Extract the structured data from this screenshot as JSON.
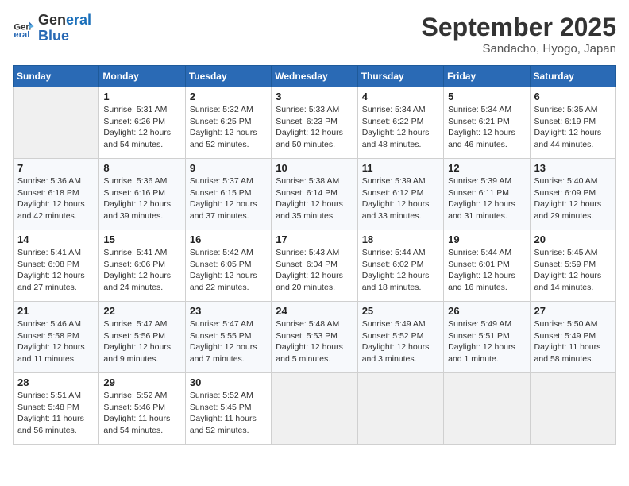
{
  "header": {
    "logo_line1": "General",
    "logo_line2": "Blue",
    "month": "September 2025",
    "location": "Sandacho, Hyogo, Japan"
  },
  "weekdays": [
    "Sunday",
    "Monday",
    "Tuesday",
    "Wednesday",
    "Thursday",
    "Friday",
    "Saturday"
  ],
  "weeks": [
    [
      {
        "day": "",
        "info": ""
      },
      {
        "day": "1",
        "info": "Sunrise: 5:31 AM\nSunset: 6:26 PM\nDaylight: 12 hours\nand 54 minutes."
      },
      {
        "day": "2",
        "info": "Sunrise: 5:32 AM\nSunset: 6:25 PM\nDaylight: 12 hours\nand 52 minutes."
      },
      {
        "day": "3",
        "info": "Sunrise: 5:33 AM\nSunset: 6:23 PM\nDaylight: 12 hours\nand 50 minutes."
      },
      {
        "day": "4",
        "info": "Sunrise: 5:34 AM\nSunset: 6:22 PM\nDaylight: 12 hours\nand 48 minutes."
      },
      {
        "day": "5",
        "info": "Sunrise: 5:34 AM\nSunset: 6:21 PM\nDaylight: 12 hours\nand 46 minutes."
      },
      {
        "day": "6",
        "info": "Sunrise: 5:35 AM\nSunset: 6:19 PM\nDaylight: 12 hours\nand 44 minutes."
      }
    ],
    [
      {
        "day": "7",
        "info": "Sunrise: 5:36 AM\nSunset: 6:18 PM\nDaylight: 12 hours\nand 42 minutes."
      },
      {
        "day": "8",
        "info": "Sunrise: 5:36 AM\nSunset: 6:16 PM\nDaylight: 12 hours\nand 39 minutes."
      },
      {
        "day": "9",
        "info": "Sunrise: 5:37 AM\nSunset: 6:15 PM\nDaylight: 12 hours\nand 37 minutes."
      },
      {
        "day": "10",
        "info": "Sunrise: 5:38 AM\nSunset: 6:14 PM\nDaylight: 12 hours\nand 35 minutes."
      },
      {
        "day": "11",
        "info": "Sunrise: 5:39 AM\nSunset: 6:12 PM\nDaylight: 12 hours\nand 33 minutes."
      },
      {
        "day": "12",
        "info": "Sunrise: 5:39 AM\nSunset: 6:11 PM\nDaylight: 12 hours\nand 31 minutes."
      },
      {
        "day": "13",
        "info": "Sunrise: 5:40 AM\nSunset: 6:09 PM\nDaylight: 12 hours\nand 29 minutes."
      }
    ],
    [
      {
        "day": "14",
        "info": "Sunrise: 5:41 AM\nSunset: 6:08 PM\nDaylight: 12 hours\nand 27 minutes."
      },
      {
        "day": "15",
        "info": "Sunrise: 5:41 AM\nSunset: 6:06 PM\nDaylight: 12 hours\nand 24 minutes."
      },
      {
        "day": "16",
        "info": "Sunrise: 5:42 AM\nSunset: 6:05 PM\nDaylight: 12 hours\nand 22 minutes."
      },
      {
        "day": "17",
        "info": "Sunrise: 5:43 AM\nSunset: 6:04 PM\nDaylight: 12 hours\nand 20 minutes."
      },
      {
        "day": "18",
        "info": "Sunrise: 5:44 AM\nSunset: 6:02 PM\nDaylight: 12 hours\nand 18 minutes."
      },
      {
        "day": "19",
        "info": "Sunrise: 5:44 AM\nSunset: 6:01 PM\nDaylight: 12 hours\nand 16 minutes."
      },
      {
        "day": "20",
        "info": "Sunrise: 5:45 AM\nSunset: 5:59 PM\nDaylight: 12 hours\nand 14 minutes."
      }
    ],
    [
      {
        "day": "21",
        "info": "Sunrise: 5:46 AM\nSunset: 5:58 PM\nDaylight: 12 hours\nand 11 minutes."
      },
      {
        "day": "22",
        "info": "Sunrise: 5:47 AM\nSunset: 5:56 PM\nDaylight: 12 hours\nand 9 minutes."
      },
      {
        "day": "23",
        "info": "Sunrise: 5:47 AM\nSunset: 5:55 PM\nDaylight: 12 hours\nand 7 minutes."
      },
      {
        "day": "24",
        "info": "Sunrise: 5:48 AM\nSunset: 5:53 PM\nDaylight: 12 hours\nand 5 minutes."
      },
      {
        "day": "25",
        "info": "Sunrise: 5:49 AM\nSunset: 5:52 PM\nDaylight: 12 hours\nand 3 minutes."
      },
      {
        "day": "26",
        "info": "Sunrise: 5:49 AM\nSunset: 5:51 PM\nDaylight: 12 hours\nand 1 minute."
      },
      {
        "day": "27",
        "info": "Sunrise: 5:50 AM\nSunset: 5:49 PM\nDaylight: 11 hours\nand 58 minutes."
      }
    ],
    [
      {
        "day": "28",
        "info": "Sunrise: 5:51 AM\nSunset: 5:48 PM\nDaylight: 11 hours\nand 56 minutes."
      },
      {
        "day": "29",
        "info": "Sunrise: 5:52 AM\nSunset: 5:46 PM\nDaylight: 11 hours\nand 54 minutes."
      },
      {
        "day": "30",
        "info": "Sunrise: 5:52 AM\nSunset: 5:45 PM\nDaylight: 11 hours\nand 52 minutes."
      },
      {
        "day": "",
        "info": ""
      },
      {
        "day": "",
        "info": ""
      },
      {
        "day": "",
        "info": ""
      },
      {
        "day": "",
        "info": ""
      }
    ]
  ]
}
